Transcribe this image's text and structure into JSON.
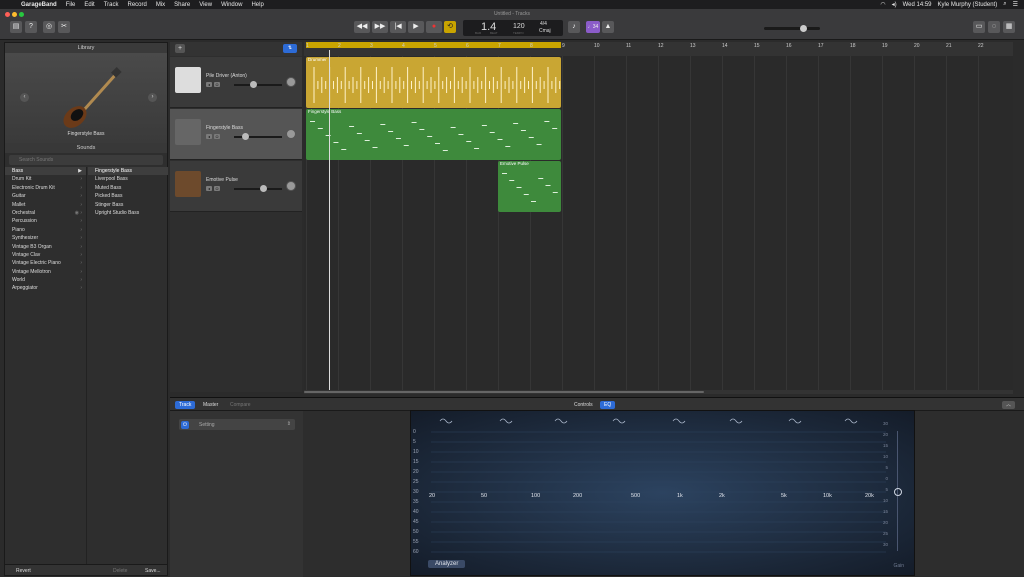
{
  "menubar": {
    "app": "GarageBand",
    "items": [
      "File",
      "Edit",
      "Track",
      "Record",
      "Mix",
      "Share",
      "View",
      "Window",
      "Help"
    ],
    "clock": "Wed 14:59",
    "user": "Kyle Murphy (Student)"
  },
  "window": {
    "title": "Untitled - Tracks"
  },
  "lcd": {
    "position": "1.4",
    "tempo": "120",
    "sig_top": "4/4",
    "key": "Cmaj",
    "bar_label": "BAR",
    "beat_label": "BEAT",
    "tempo_label": "TEMPO"
  },
  "toolbar": {
    "count_in": "♩34"
  },
  "library": {
    "title": "Library",
    "instrument": "Fingerstyle Bass",
    "sounds_header": "Sounds",
    "search_placeholder": "Search Sounds",
    "categories": [
      "Bass",
      "Drum Kit",
      "Electronic Drum Kit",
      "Guitar",
      "Mallet",
      "Orchestral",
      "Percussion",
      "Piano",
      "Synthesizer",
      "Vintage B3 Organ",
      "Vintage Clav",
      "Vintage Electric Piano",
      "Vintage Mellotron",
      "World",
      "Arpeggiator"
    ],
    "patches": [
      "Fingerstyle Bass",
      "Liverpool Bass",
      "Muted Bass",
      "Picked Bass",
      "Stinger Bass",
      "Upright Studio Bass"
    ],
    "revert": "Revert",
    "delete": "Delete",
    "save": "Save..."
  },
  "tracks": [
    {
      "name": "Pile Driver (Anton)"
    },
    {
      "name": "Fingerstyle Bass"
    },
    {
      "name": "Emotive Pulse"
    }
  ],
  "ruler": [
    "1",
    "2",
    "3",
    "4",
    "5",
    "6",
    "7",
    "8",
    "9",
    "10",
    "11",
    "12",
    "13",
    "14",
    "15",
    "16",
    "17",
    "18",
    "19",
    "20",
    "21",
    "22"
  ],
  "regions": {
    "drummer": "Drummer",
    "bass": "Fingerstyle Bass",
    "pulse": "Emotive Pulse"
  },
  "editor": {
    "tabs": [
      "Track",
      "Master",
      "Compare"
    ],
    "setting": "Setting",
    "controls": "Controls",
    "eq": "EQ",
    "analyzer": "Analyzer",
    "gain": "Gain",
    "db_left": [
      "0",
      "5",
      "10",
      "15",
      "20",
      "25",
      "30",
      "35",
      "40",
      "45",
      "50",
      "55",
      "60"
    ],
    "db_right": [
      "30",
      "20",
      "15",
      "10",
      "5",
      "0",
      "5",
      "10",
      "15",
      "20",
      "25",
      "30"
    ],
    "freqs": [
      "20",
      "50",
      "100",
      "200",
      "500",
      "1k",
      "2k",
      "5k",
      "10k",
      "20k"
    ]
  }
}
